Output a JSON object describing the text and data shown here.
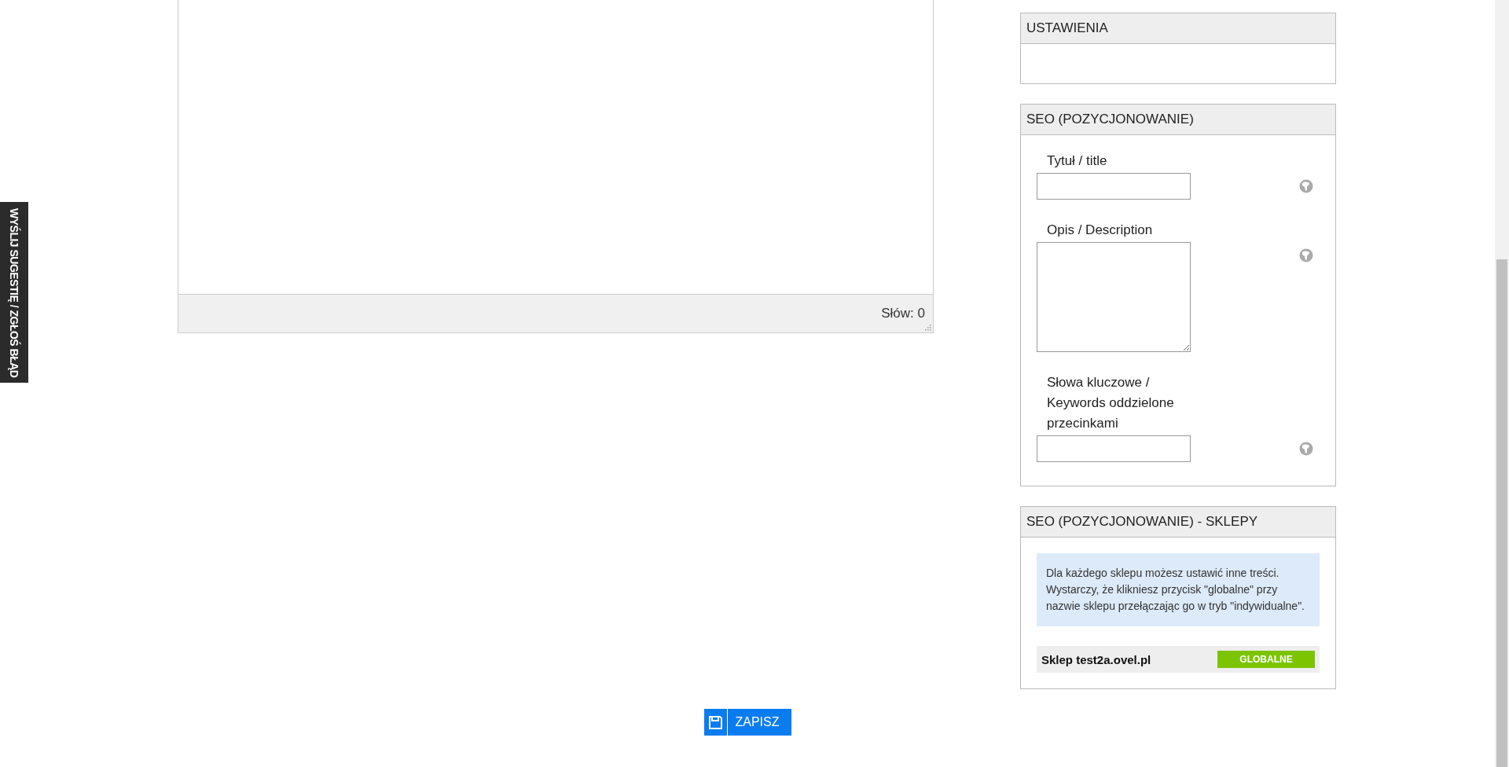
{
  "feedback_tab": {
    "label": "WYŚLIJ SUGESTIĘ / ZGŁOŚ BŁĄD"
  },
  "editor": {
    "word_count": "Słów: 0"
  },
  "panels": [
    {
      "title": "USTAWIENIA"
    },
    {
      "title": "SEO (POZYCJONOWANIE)",
      "fields": [
        {
          "kind": "input",
          "label": "Tytuł / title"
        },
        {
          "kind": "textarea",
          "label": "Opis / Description"
        },
        {
          "kind": "input",
          "label": "Słowa kluczowe / Keywords oddzielone przecinkami"
        }
      ]
    },
    {
      "title": "SEO (POZYCJONOWANIE) - SKLEPY",
      "info": "Dla każdego sklepu możesz ustawić inne treści. Wystarczy, że klikniesz przycisk \"globalne\" przy nazwie sklepu przełączając go w tryb \"indywidualne\".",
      "shops": [
        {
          "name": "Sklep test2a.ovel.pl",
          "mode": "GLOBALNE"
        }
      ]
    }
  ],
  "save_button": {
    "label": "ZAPISZ"
  }
}
